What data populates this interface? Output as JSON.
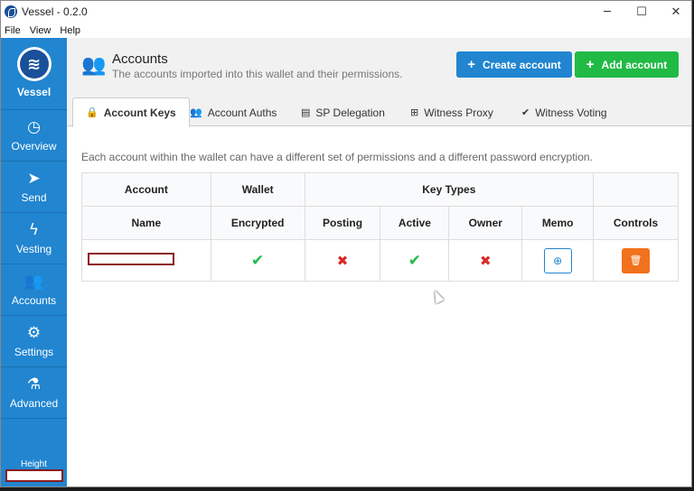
{
  "window": {
    "title": "Vessel - 0.2.0",
    "minimize": "─",
    "maximize": "☐",
    "close": "✕"
  },
  "menu": [
    "File",
    "View",
    "Help"
  ],
  "sidebar": {
    "brand": "Vessel",
    "brand_icon": "steem-logo-icon",
    "items": [
      {
        "label": "Overview",
        "icon": "tachometer-icon",
        "glyph": "◷"
      },
      {
        "label": "Send",
        "icon": "paper-plane-icon",
        "glyph": "➤"
      },
      {
        "label": "Vesting",
        "icon": "lightning-icon",
        "glyph": "ϟ"
      },
      {
        "label": "Accounts",
        "icon": "users-icon",
        "glyph": "👥"
      },
      {
        "label": "Settings",
        "icon": "cogs-icon",
        "glyph": "⚙"
      },
      {
        "label": "Advanced",
        "icon": "flask-icon",
        "glyph": "⚗"
      }
    ],
    "height_label": "Height"
  },
  "header": {
    "title": "Accounts",
    "subtitle": "The accounts imported into this wallet and their permissions.",
    "create_label": "Create account",
    "add_label": "Add account"
  },
  "tabs": [
    {
      "label": "Account Keys",
      "icon": "lock-icon",
      "glyph": "🔒"
    },
    {
      "label": "Account Auths",
      "icon": "users-icon",
      "glyph": "👥"
    },
    {
      "label": "SP Delegation",
      "icon": "server-icon",
      "glyph": "▤"
    },
    {
      "label": "Witness Proxy",
      "icon": "sitemap-icon",
      "glyph": "⊞"
    },
    {
      "label": "Witness Voting",
      "icon": "checkmark-icon",
      "glyph": "✔"
    }
  ],
  "description": "Each account within the wallet can have a different set of permissions and a different password encryption.",
  "table": {
    "group_headers": {
      "account": "Account",
      "wallet": "Wallet",
      "key_types": "Key Types"
    },
    "headers": {
      "name": "Name",
      "encrypted": "Encrypted",
      "posting": "Posting",
      "active": "Active",
      "owner": "Owner",
      "memo": "Memo",
      "controls": "Controls"
    },
    "rows": [
      {
        "encrypted": true,
        "posting": false,
        "active": true,
        "owner": false
      }
    ]
  }
}
